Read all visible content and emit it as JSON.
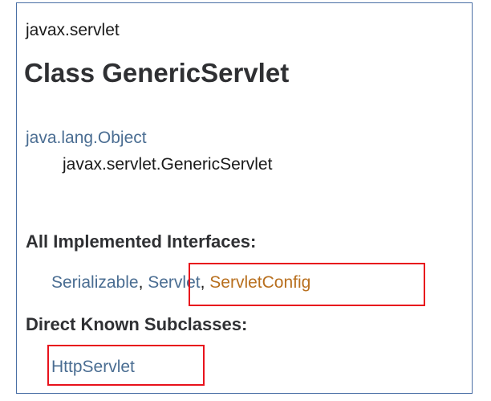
{
  "package_name": "javax.servlet",
  "class_title": "Class GenericServlet",
  "inheritance": {
    "parent": "java.lang.Object",
    "self": "javax.servlet.GenericServlet"
  },
  "implemented_interfaces": {
    "heading": "All Implemented Interfaces:",
    "items": [
      "Serializable",
      "Servlet",
      "ServletConfig"
    ],
    "separator": ", "
  },
  "known_subclasses": {
    "heading": "Direct Known Subclasses:",
    "items": [
      "HttpServlet"
    ]
  },
  "colors": {
    "link": "#4a6d92",
    "visited_link": "#b86f1e",
    "highlight_box": "#e8121c",
    "frame_border": "#4a6fa5"
  }
}
